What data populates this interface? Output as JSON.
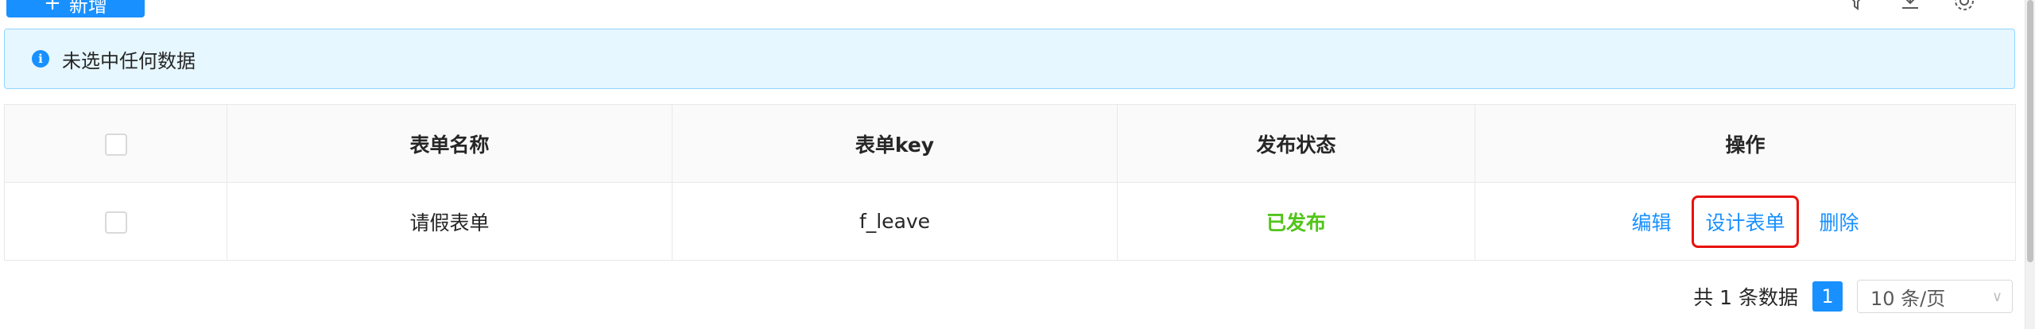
{
  "toolbar": {
    "add_label": "新增",
    "icons": [
      "filter-icon",
      "download-icon",
      "settings-icon"
    ]
  },
  "alert": {
    "message": "未选中任何数据"
  },
  "table": {
    "columns": [
      "表单名称",
      "表单key",
      "发布状态",
      "操作"
    ],
    "rows": [
      {
        "name": "请假表单",
        "key": "f_leave",
        "status": "已发布",
        "actions": [
          "编辑",
          "设计表单",
          "删除"
        ]
      }
    ]
  },
  "pagination": {
    "total_text": "共 1 条数据",
    "current_page": "1",
    "page_size": "10 条/页"
  },
  "colors": {
    "primary": "#1890ff",
    "success": "#52c41a",
    "highlight": "#e8120c"
  }
}
